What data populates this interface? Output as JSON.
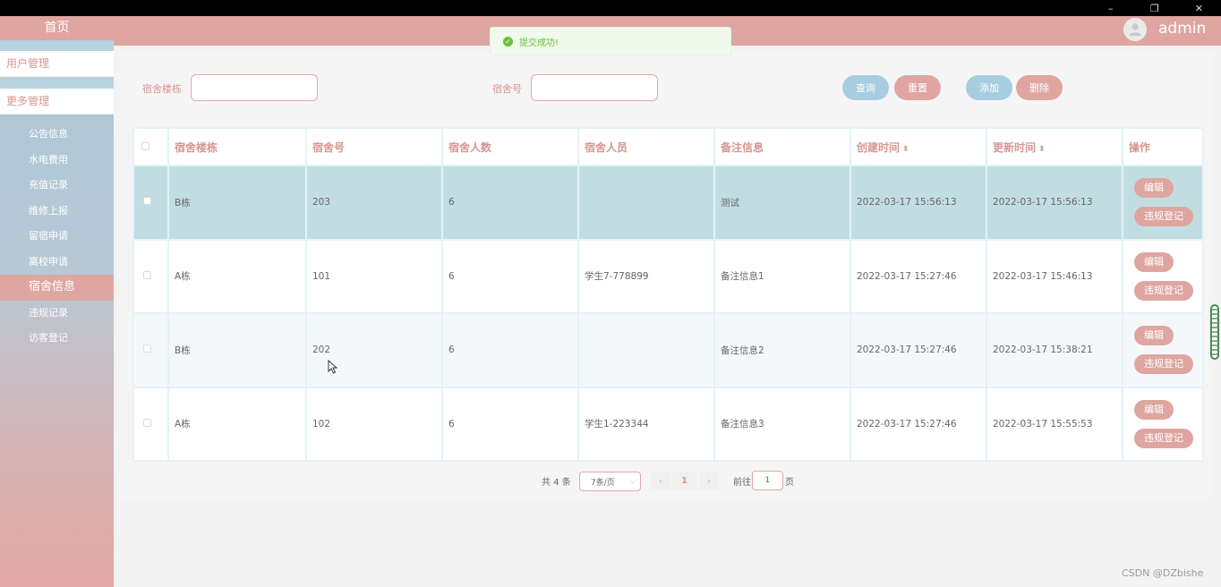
{
  "window": {
    "minimize": "–",
    "restore": "❐",
    "close": "✕"
  },
  "sidebar": {
    "home": "首页",
    "groups": [
      "用户管理",
      "更多管理"
    ],
    "items": [
      {
        "label": "公告信息"
      },
      {
        "label": "水电费用"
      },
      {
        "label": "充值记录"
      },
      {
        "label": "维修上报"
      },
      {
        "label": "留宿申请"
      },
      {
        "label": "离校申请"
      },
      {
        "label": "宿舍信息",
        "active": true
      },
      {
        "label": "违规记录"
      },
      {
        "label": "访客登记"
      }
    ]
  },
  "header": {
    "username": "admin"
  },
  "toast": {
    "text": "提交成功!"
  },
  "filters": {
    "building_label": "宿舍楼栋",
    "building_value": "",
    "room_label": "宿舍号",
    "room_value": ""
  },
  "actions": {
    "query": "查询",
    "reset": "重置",
    "add": "添加",
    "delete": "删除"
  },
  "table": {
    "columns": [
      "宿舍楼栋",
      "宿舍号",
      "宿舍人数",
      "宿舍人员",
      "备注信息",
      "创建时间",
      "更新时间",
      "操作"
    ],
    "rows": [
      {
        "building": "B栋",
        "room": "203",
        "count": "6",
        "members": "",
        "remark": "测试",
        "created": "2022-03-17 15:56:13",
        "updated": "2022-03-17 15:56:13"
      },
      {
        "building": "A栋",
        "room": "101",
        "count": "6",
        "members": "学生7-778899",
        "remark": "备注信息1",
        "created": "2022-03-17 15:27:46",
        "updated": "2022-03-17 15:46:13"
      },
      {
        "building": "B栋",
        "room": "202",
        "count": "6",
        "members": "",
        "remark": "备注信息2",
        "created": "2022-03-17 15:27:46",
        "updated": "2022-03-17 15:38:21"
      },
      {
        "building": "A栋",
        "room": "102",
        "count": "6",
        "members": "学生1-223344",
        "remark": "备注信息3",
        "created": "2022-03-17 15:27:46",
        "updated": "2022-03-17 15:55:53"
      }
    ],
    "edit_label": "编辑",
    "violation_label": "违规登记",
    "sort_icon": "sort-icon"
  },
  "pagination": {
    "total": "共 4 条",
    "page_size": "7条/页",
    "current": "1",
    "goto_prefix": "前往",
    "goto_value": "1",
    "goto_suffix": "页"
  },
  "watermark": "CSDN @DZbishe",
  "colors": {
    "accent": "#dfa6a1",
    "blue": "#a9cde0",
    "success": "#67c23a"
  }
}
